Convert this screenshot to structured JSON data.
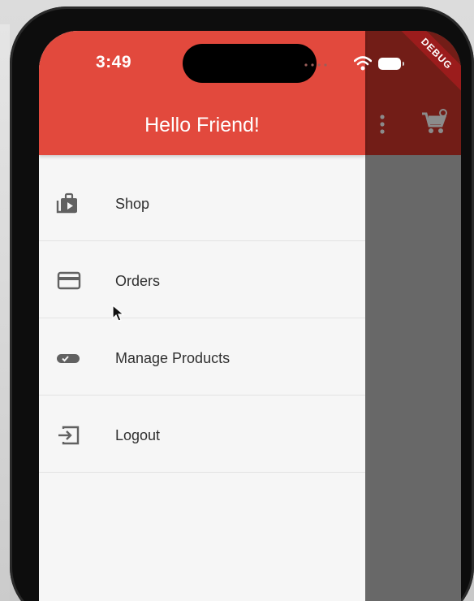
{
  "status_bar": {
    "time": "3:49"
  },
  "app_bar": {
    "actions": [
      "more-vert-icon",
      "shopping-cart-icon"
    ]
  },
  "debug_banner": "DEBUG",
  "drawer": {
    "title": "Hello Friend!",
    "items": [
      {
        "label": "Shop",
        "icon": "shop-icon"
      },
      {
        "label": "Orders",
        "icon": "payment-card-icon"
      },
      {
        "label": "Manage Products",
        "icon": "toggle-on-icon"
      },
      {
        "label": "Logout",
        "icon": "exit-icon"
      }
    ]
  },
  "colors": {
    "drawer_header": "#e2493d",
    "app_bar_dimmed": "#721d17",
    "scrim": "#686868",
    "drawer_background": "#f6f6f6",
    "text_primary": "#303030",
    "icon_color": "#616161",
    "debug_banner": "#9b1c1c"
  }
}
